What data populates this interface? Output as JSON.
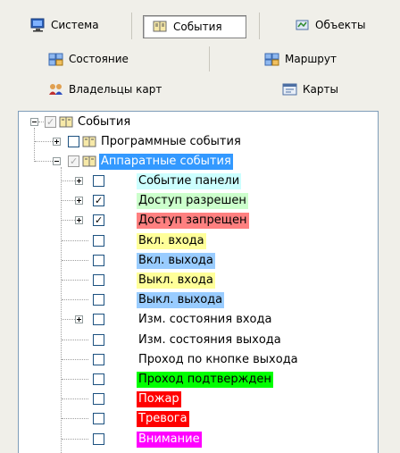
{
  "toolbar": {
    "row1": [
      {
        "label": "Система",
        "icon": "monitor-icon",
        "pressed": false
      },
      {
        "label": "События",
        "icon": "book-icon",
        "pressed": true
      },
      {
        "label": "Объекты",
        "icon": "objects-icon",
        "pressed": false
      }
    ],
    "row2": [
      {
        "label": "Состояние",
        "icon": "state-icon"
      },
      {
        "label": "Маршрут",
        "icon": "route-icon"
      }
    ],
    "row3": [
      {
        "label": "Владельцы карт",
        "icon": "owners-icon"
      },
      {
        "label": "Карты",
        "icon": "card-icon"
      }
    ]
  },
  "tree": {
    "root": {
      "label": "События",
      "checked": "partial"
    },
    "groups": [
      {
        "label": "Программные события",
        "checked": false,
        "expanded": false
      },
      {
        "label": "Аппаратные события",
        "checked": "partial",
        "expanded": true,
        "selected": true
      }
    ],
    "events": [
      {
        "label": "Событие панели",
        "checked": false,
        "has_children": true,
        "color": "#ccffff"
      },
      {
        "label": "Доступ разрешен",
        "checked": true,
        "has_children": true,
        "color": "#ccffcc"
      },
      {
        "label": "Доступ запрещен",
        "checked": true,
        "has_children": true,
        "color": "#ff8080"
      },
      {
        "label": "Вкл. входа",
        "checked": false,
        "has_children": false,
        "color": "#ffff99"
      },
      {
        "label": "Вкл. выхода",
        "checked": false,
        "has_children": false,
        "color": "#99ccff"
      },
      {
        "label": "Выкл. входа",
        "checked": false,
        "has_children": false,
        "color": "#ffff99"
      },
      {
        "label": "Выкл. выхода",
        "checked": false,
        "has_children": false,
        "color": "#99ccff"
      },
      {
        "label": "Изм. состояния входа",
        "checked": false,
        "has_children": true,
        "color": ""
      },
      {
        "label": "Изм. состояния выхода",
        "checked": false,
        "has_children": false,
        "color": ""
      },
      {
        "label": "Проход по кнопке выхода",
        "checked": false,
        "has_children": false,
        "color": ""
      },
      {
        "label": "Проход подтвержден",
        "checked": false,
        "has_children": false,
        "color": "#00ff00"
      },
      {
        "label": "Пожар",
        "checked": false,
        "has_children": false,
        "color": "#ff0000",
        "text_color": "#ffffff"
      },
      {
        "label": "Тревога",
        "checked": false,
        "has_children": false,
        "color": "#ff0000",
        "text_color": "#ffffff"
      },
      {
        "label": "Внимание",
        "checked": false,
        "has_children": false,
        "color": "#ff00ff",
        "text_color": "#ffffff"
      }
    ],
    "selection_color": "#3399ff"
  }
}
